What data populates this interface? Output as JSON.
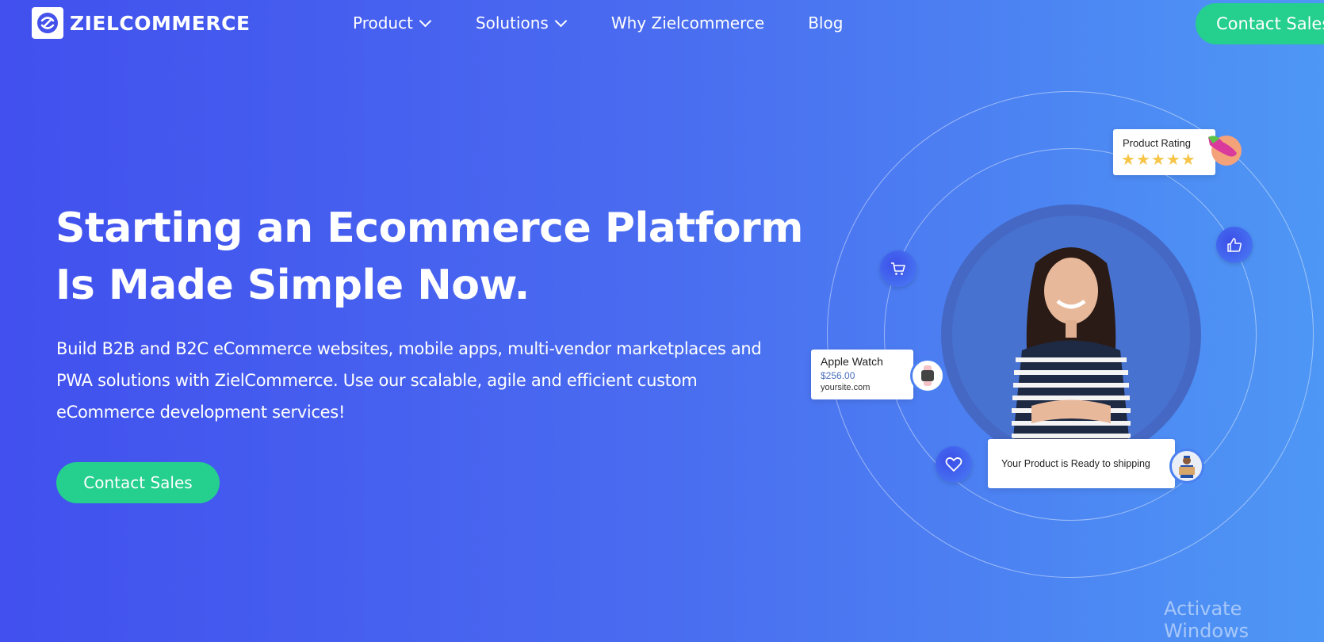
{
  "nav": {
    "brand": "ZIELCOMMERCE",
    "items": [
      {
        "label": "Product",
        "has_dropdown": true
      },
      {
        "label": "Solutions",
        "has_dropdown": true
      },
      {
        "label": "Why Zielcommerce",
        "has_dropdown": false
      },
      {
        "label": "Blog",
        "has_dropdown": false
      }
    ],
    "cta_label": "Contact Sales"
  },
  "hero": {
    "headline_line1": "Starting an Ecommerce Platform",
    "headline_line2": "Is Made Simple Now.",
    "subtitle": "Build B2B and B2C eCommerce websites, mobile apps, multi-vendor marketplaces and PWA solutions with ZielCommerce. Use our scalable, agile and efficient custom eCommerce development services!",
    "cta_label": "Contact Sales"
  },
  "illustration": {
    "rating_card": {
      "title": "Product Rating",
      "stars": 5,
      "max_stars": 5
    },
    "product_card": {
      "name": "Apple Watch",
      "price": "$256.00",
      "site": "yoursite.com"
    },
    "shipping_card": {
      "text": "Your Product is Ready to shipping"
    }
  },
  "colors": {
    "accent_green": "#25cf8e",
    "bg_left": "#4150ee",
    "bg_right": "#4e97f5",
    "star": "#f7c548",
    "price": "#4a6fbf"
  },
  "watermark": "Activate Windows"
}
